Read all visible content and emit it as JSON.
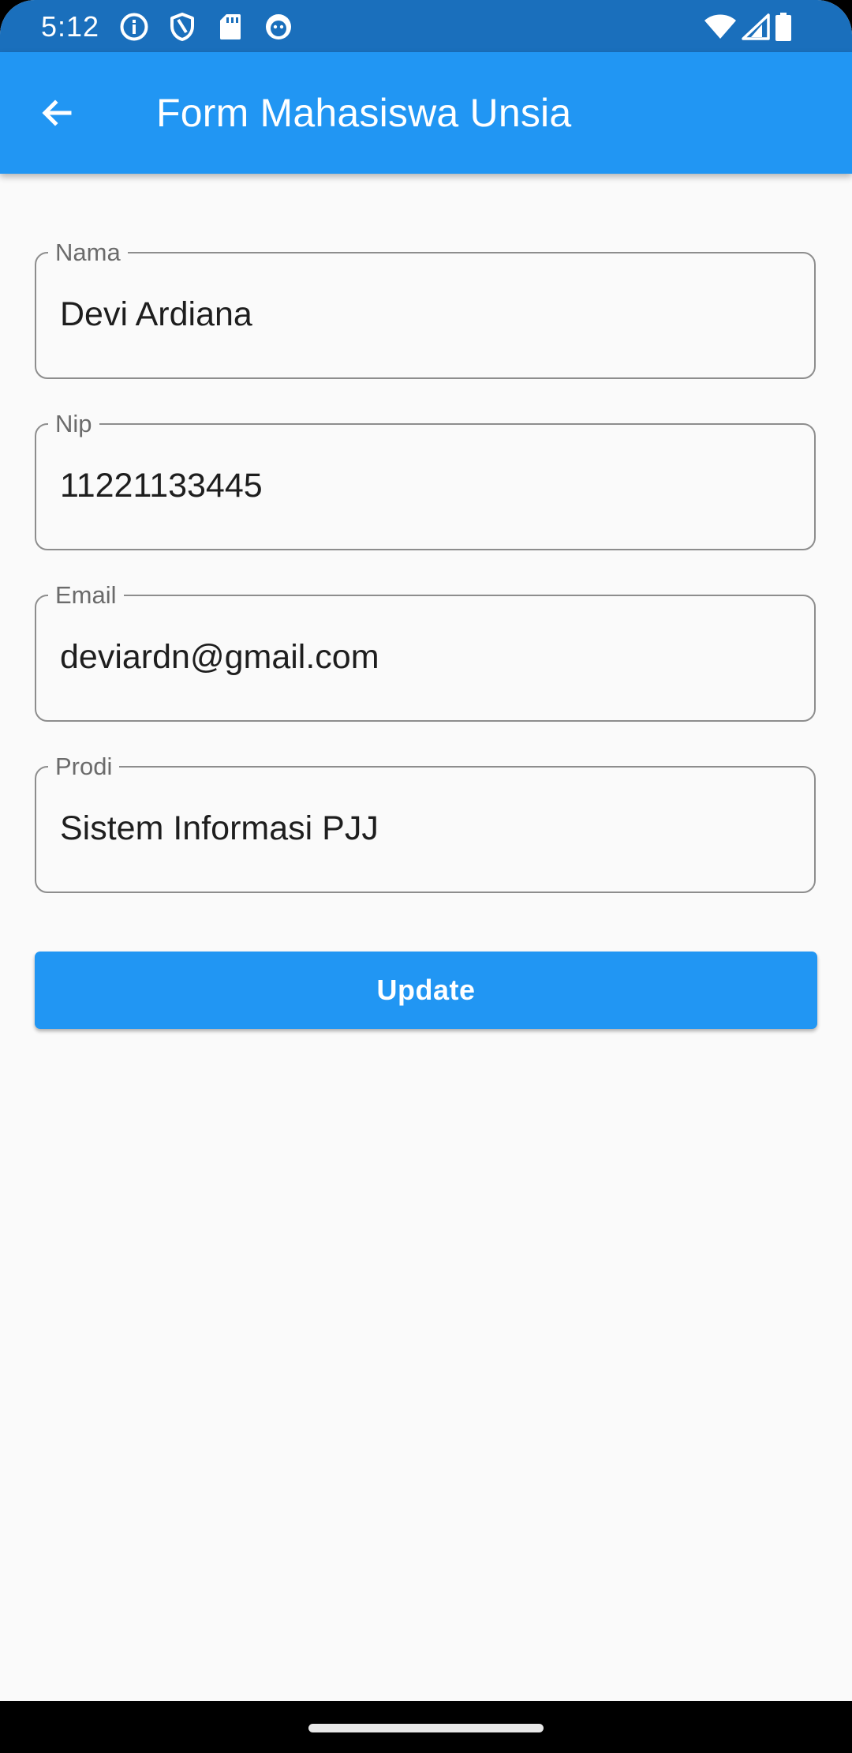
{
  "status_bar": {
    "time": "5:12",
    "left_icons": [
      "info-icon",
      "shield-icon",
      "sd-card-icon",
      "android-debug-icon"
    ],
    "right_icons": [
      "wifi-icon",
      "cell-signal-icon",
      "battery-icon"
    ],
    "background": "#1a6fbc"
  },
  "app_bar": {
    "title": "Form Mahasiswa Unsia",
    "back_icon": "arrow-back-icon",
    "background": "#2196f3"
  },
  "form": {
    "fields": [
      {
        "label": "Nama",
        "value": "Devi Ardiana"
      },
      {
        "label": "Nip",
        "value": "11221133445"
      },
      {
        "label": "Email",
        "value": "deviardn@gmail.com"
      },
      {
        "label": "Prodi",
        "value": "Sistem Informasi PJJ"
      }
    ],
    "submit_label": "Update",
    "accent": "#2196f3"
  }
}
